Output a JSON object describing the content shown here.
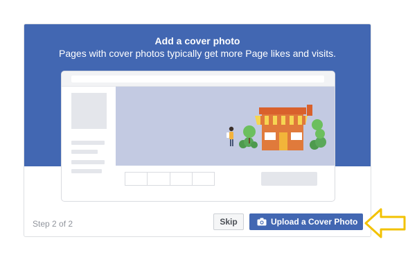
{
  "dialog": {
    "title": "Add a cover photo",
    "subtitle": "Pages with cover photos typically get more Page likes and visits.",
    "step_label": "Step 2 of 2",
    "skip_label": "Skip",
    "upload_label": "Upload a Cover Photo",
    "upload_icon": "camera-icon"
  },
  "colors": {
    "brand_blue": "#4267b2",
    "cover_placeholder": "#c3cae2",
    "arrow_outline": "#f2c200"
  },
  "annotation": {
    "arrow_icon": "left-arrow-icon"
  }
}
